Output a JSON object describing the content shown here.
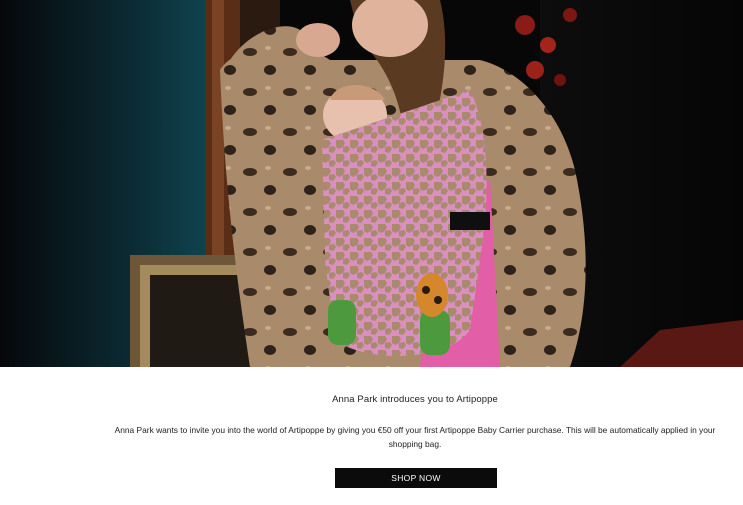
{
  "promo": {
    "headline": "Anna Park introduces you to Artipoppe",
    "body": "Anna Park wants to invite you into the world of Artipoppe by giving you €50 off your first Artipoppe Baby Carrier purchase. This will be automatically applied in your shopping bag.",
    "cta_label": "SHOP NOW"
  },
  "colors": {
    "background": "#ffffff",
    "cta_background": "#0b0b0b",
    "cta_text": "#ffffff",
    "text": "#222222",
    "carrier_pink": "#d98fbf"
  }
}
